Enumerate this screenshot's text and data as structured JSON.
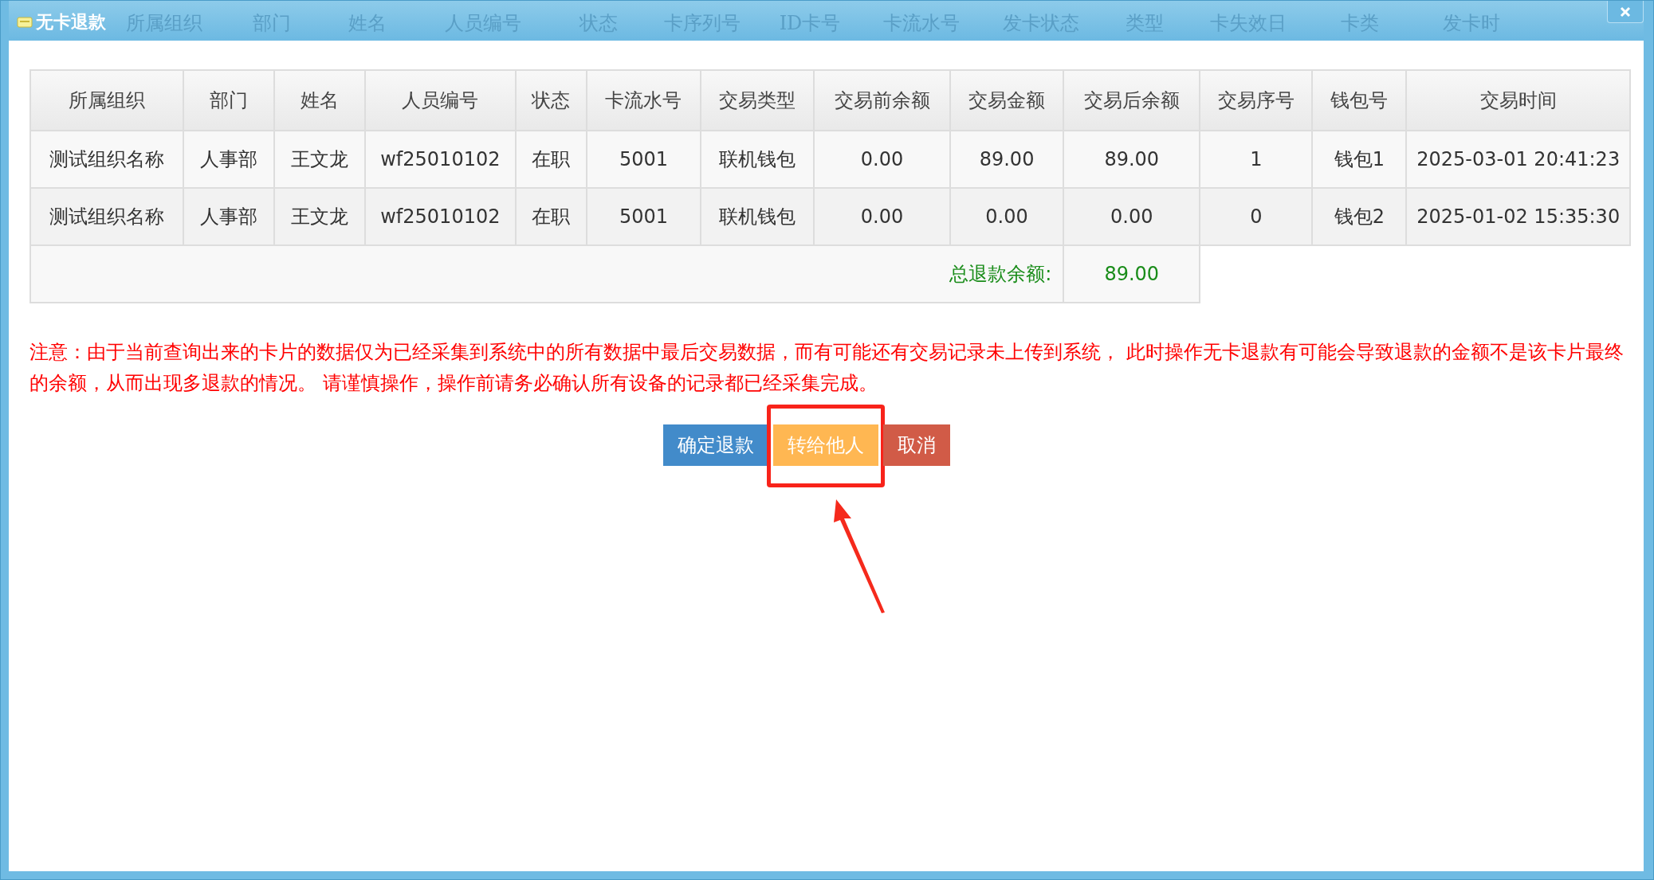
{
  "window": {
    "title": "无卡退款"
  },
  "background_columns": [
    "所属组织",
    "部门",
    "姓名",
    "人员编号",
    "状态",
    "卡序列号",
    "ID卡号",
    "卡流水号",
    "发卡状态",
    "类型",
    "卡失效日",
    "卡类",
    "发卡时"
  ],
  "table": {
    "columns": [
      "所属组织",
      "部门",
      "姓名",
      "人员编号",
      "状态",
      "卡流水号",
      "交易类型",
      "交易前余额",
      "交易金额",
      "交易后余额",
      "交易序号",
      "钱包号",
      "交易时间"
    ],
    "rows": [
      [
        "测试组织名称",
        "人事部",
        "王文龙",
        "wf25010102",
        "在职",
        "5001",
        "联机钱包",
        "0.00",
        "89.00",
        "89.00",
        "1",
        "钱包1",
        "2025-03-01 20:41:23"
      ],
      [
        "测试组织名称",
        "人事部",
        "王文龙",
        "wf25010102",
        "在职",
        "5001",
        "联机钱包",
        "0.00",
        "0.00",
        "0.00",
        "0",
        "钱包2",
        "2025-01-02 15:35:30"
      ]
    ],
    "total": {
      "label": "总退款余额:",
      "value": "89.00"
    }
  },
  "notice": "注意：由于当前查询出来的卡片的数据仅为已经采集到系统中的所有数据中最后交易数据，而有可能还有交易记录未上传到系统， 此时操作无卡退款有可能会导致退款的金额不是该卡片最终的余额，从而出现多退款的情况。 请谨慎操作，操作前请务必确认所有设备的记录都已经采集完成。",
  "buttons": [
    {
      "label": "确定退款",
      "kind": "primary"
    },
    {
      "label": "转给他人",
      "kind": "warning",
      "highlighted": true
    },
    {
      "label": "取消",
      "kind": "danger"
    }
  ]
}
